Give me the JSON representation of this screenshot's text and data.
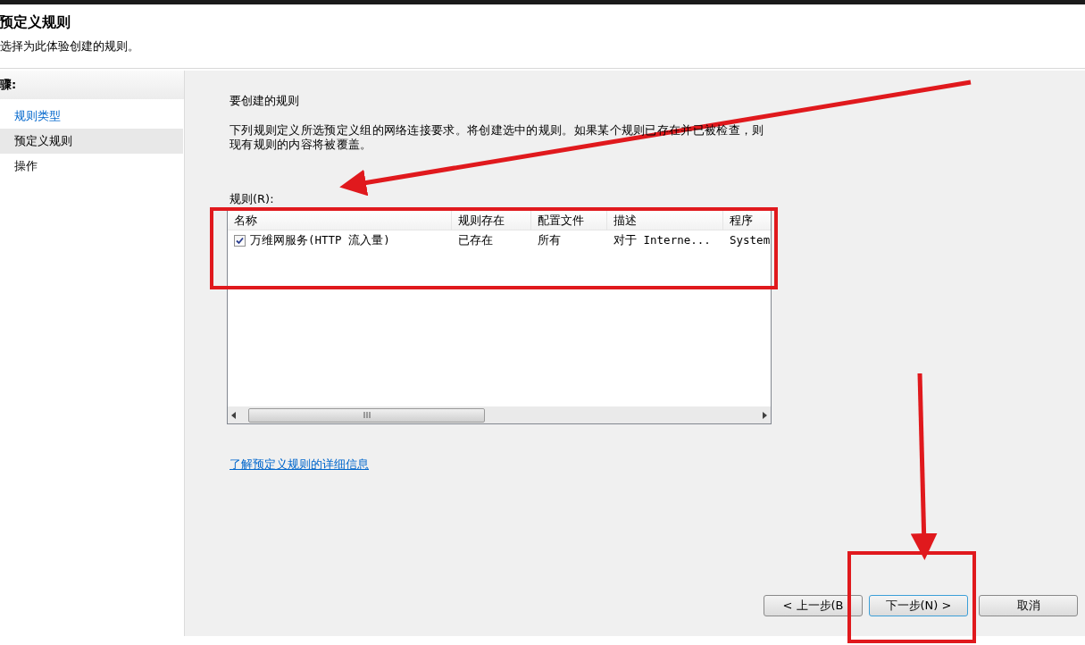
{
  "header": {
    "title": "预定义规则",
    "subtitle": "选择为此体验创建的规则。"
  },
  "steps": {
    "heading": "骤:",
    "items": [
      {
        "label": "规则类型",
        "selected": false,
        "kind": "link"
      },
      {
        "label": "预定义规则",
        "selected": true,
        "kind": "current"
      },
      {
        "label": "操作",
        "selected": false,
        "kind": "pending"
      }
    ]
  },
  "main": {
    "heading": "要创建的规则",
    "description": "下列规则定义所选预定义组的网络连接要求。将创建选中的规则。如果某个规则已存在并已被检查，则现有规则的内容将被覆盖。",
    "list_label": "规则(R):",
    "table": {
      "columns": [
        "名称",
        "规则存在",
        "配置文件",
        "描述",
        "程序"
      ],
      "rows": [
        {
          "checked": true,
          "cells": [
            "万维网服务(HTTP 流入量)",
            "已存在",
            "所有",
            "对于 Interne...",
            "System"
          ]
        }
      ]
    },
    "link": "了解预定义规则的详细信息"
  },
  "buttons": [
    {
      "label": "< 上一步(B",
      "kind": "back"
    },
    {
      "label": "下一步(N) >",
      "kind": "default"
    },
    {
      "label": "取消",
      "kind": "cancel"
    }
  ]
}
